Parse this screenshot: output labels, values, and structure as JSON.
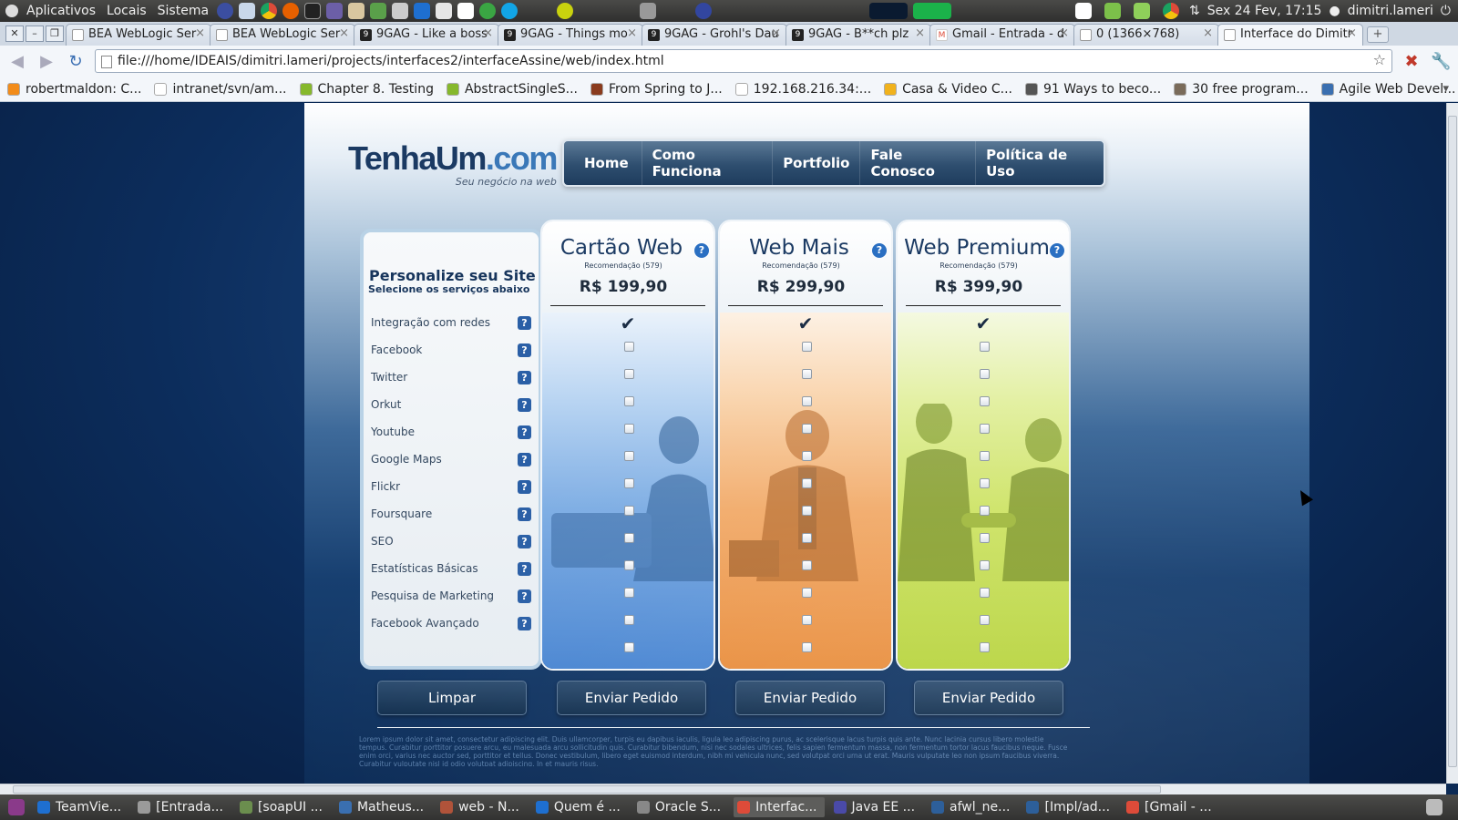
{
  "panel": {
    "menus": [
      "Aplicativos",
      "Locais",
      "Sistema"
    ],
    "clock": "Sex 24 Fev, 17:15",
    "user": "dimitri.lameri"
  },
  "browser": {
    "tabs": [
      {
        "label": "BEA WebLogic Ser",
        "icon": "page-icon"
      },
      {
        "label": "BEA WebLogic Ser",
        "icon": "page-icon"
      },
      {
        "label": "9GAG - Like a boss",
        "icon": "9gag-icon"
      },
      {
        "label": "9GAG - Things mo",
        "icon": "9gag-icon"
      },
      {
        "label": "9GAG - Grohl's Dau",
        "icon": "9gag-icon"
      },
      {
        "label": "9GAG - B**ch plz",
        "icon": "9gag-icon"
      },
      {
        "label": "Gmail - Entrada - d",
        "icon": "gmail-icon"
      },
      {
        "label": "0 (1366×768)",
        "icon": "page-icon"
      },
      {
        "label": "Interface do Dimitr",
        "icon": "page-icon"
      }
    ],
    "url": "file:///home/IDEAIS/dimitri.lameri/projects/interfaces2/interfaceAssine/web/index.html",
    "bookmarks": [
      {
        "label": "robertmaldon: C...",
        "color": "#f28c1a"
      },
      {
        "label": "intranet/svn/am...",
        "color": "#ffffff"
      },
      {
        "label": "Chapter 8. Testing",
        "color": "#86b82c"
      },
      {
        "label": "AbstractSingleS...",
        "color": "#86b82c"
      },
      {
        "label": "From Spring to J...",
        "color": "#8a3b1d"
      },
      {
        "label": "192.168.216.34:...",
        "color": "#ffffff"
      },
      {
        "label": "Casa & Video C...",
        "color": "#f1b21c"
      },
      {
        "label": "91 Ways to beco...",
        "color": "#555555"
      },
      {
        "label": "30 free program...",
        "color": "#7a6b5a"
      },
      {
        "label": "Agile Web Devel...",
        "color": "#3a6fb0"
      }
    ]
  },
  "site": {
    "logo": {
      "name": "TenhaUm",
      "domain": ".com",
      "tagline": "Seu negócio na web"
    },
    "nav": [
      "Home",
      "Como Funciona",
      "Portfolio",
      "Fale Conosco",
      "Política de Uso"
    ],
    "panel_title": "Personalize seu Site",
    "panel_subtitle": "Selecione os serviços abaixo",
    "features": [
      "Integração com redes",
      "Facebook",
      "Twitter",
      "Orkut",
      "Youtube",
      "Google Maps",
      "Flickr",
      "Foursquare",
      "SEO",
      "Estatísticas Básicas",
      "Pesquisa de Marketing",
      "Facebook Avançado"
    ],
    "plans": [
      {
        "name": "Cartão Web",
        "recommendation": "Recomendação (579)",
        "price": "R$ 199,90",
        "theme": "blue",
        "button": "Enviar Pedido"
      },
      {
        "name": "Web Mais",
        "recommendation": "Recomendação (579)",
        "price": "R$ 299,90",
        "theme": "orange",
        "button": "Enviar Pedido"
      },
      {
        "name": "Web Premium",
        "recommendation": "Recomendação (579)",
        "price": "R$ 399,90",
        "theme": "green",
        "button": "Enviar Pedido"
      }
    ],
    "clear_button": "Limpar",
    "help_glyph": "?",
    "check_glyph": "✔",
    "lorem": "Lorem ipsum dolor sit amet, consectetur adipiscing elit. Duis ullamcorper, turpis eu dapibus iaculis, ligula leo adipiscing purus, ac scelerisque lacus turpis quis ante. Nunc lacinia cursus libero molestie tempus. Curabitur porttitor posuere arcu, eu malesuada arcu sollicitudin quis. Curabitur bibendum, nisi nec sodales ultrices, felis sapien fermentum massa, non fermentum tortor lacus faucibus neque. Fusce enim orci, varius nec auctor sed, porttitor et tellus. Donec vestibulum, libero eget euismod interdum, nibh mi vehicula nunc, sed volutpat orci urna ut erat. Mauris vulputate leo non ipsum faucibus viverra. Curabitur vulputate nisl id odio volutpat adipiscing. In et mauris risus."
  },
  "taskbar": [
    {
      "label": "TeamVie...",
      "color": "#1e6fd0"
    },
    {
      "label": "[Entrada...",
      "color": "#9a9a9a"
    },
    {
      "label": "[soapUI ...",
      "color": "#6b8e4e"
    },
    {
      "label": "Matheus...",
      "color": "#3a6fb0"
    },
    {
      "label": "web - N...",
      "color": "#b0533a"
    },
    {
      "label": "Quem é ...",
      "color": "#1e6fd0"
    },
    {
      "label": "Oracle S...",
      "color": "#888888"
    },
    {
      "label": "Interfac...",
      "color": "#dd4b39"
    },
    {
      "label": "Java EE ...",
      "color": "#4a4aa8"
    },
    {
      "label": "afwl_ne...",
      "color": "#2d5f9a"
    },
    {
      "label": "[Impl/ad...",
      "color": "#2d5f9a"
    },
    {
      "label": "[Gmail - ...",
      "color": "#dd4b39"
    }
  ]
}
